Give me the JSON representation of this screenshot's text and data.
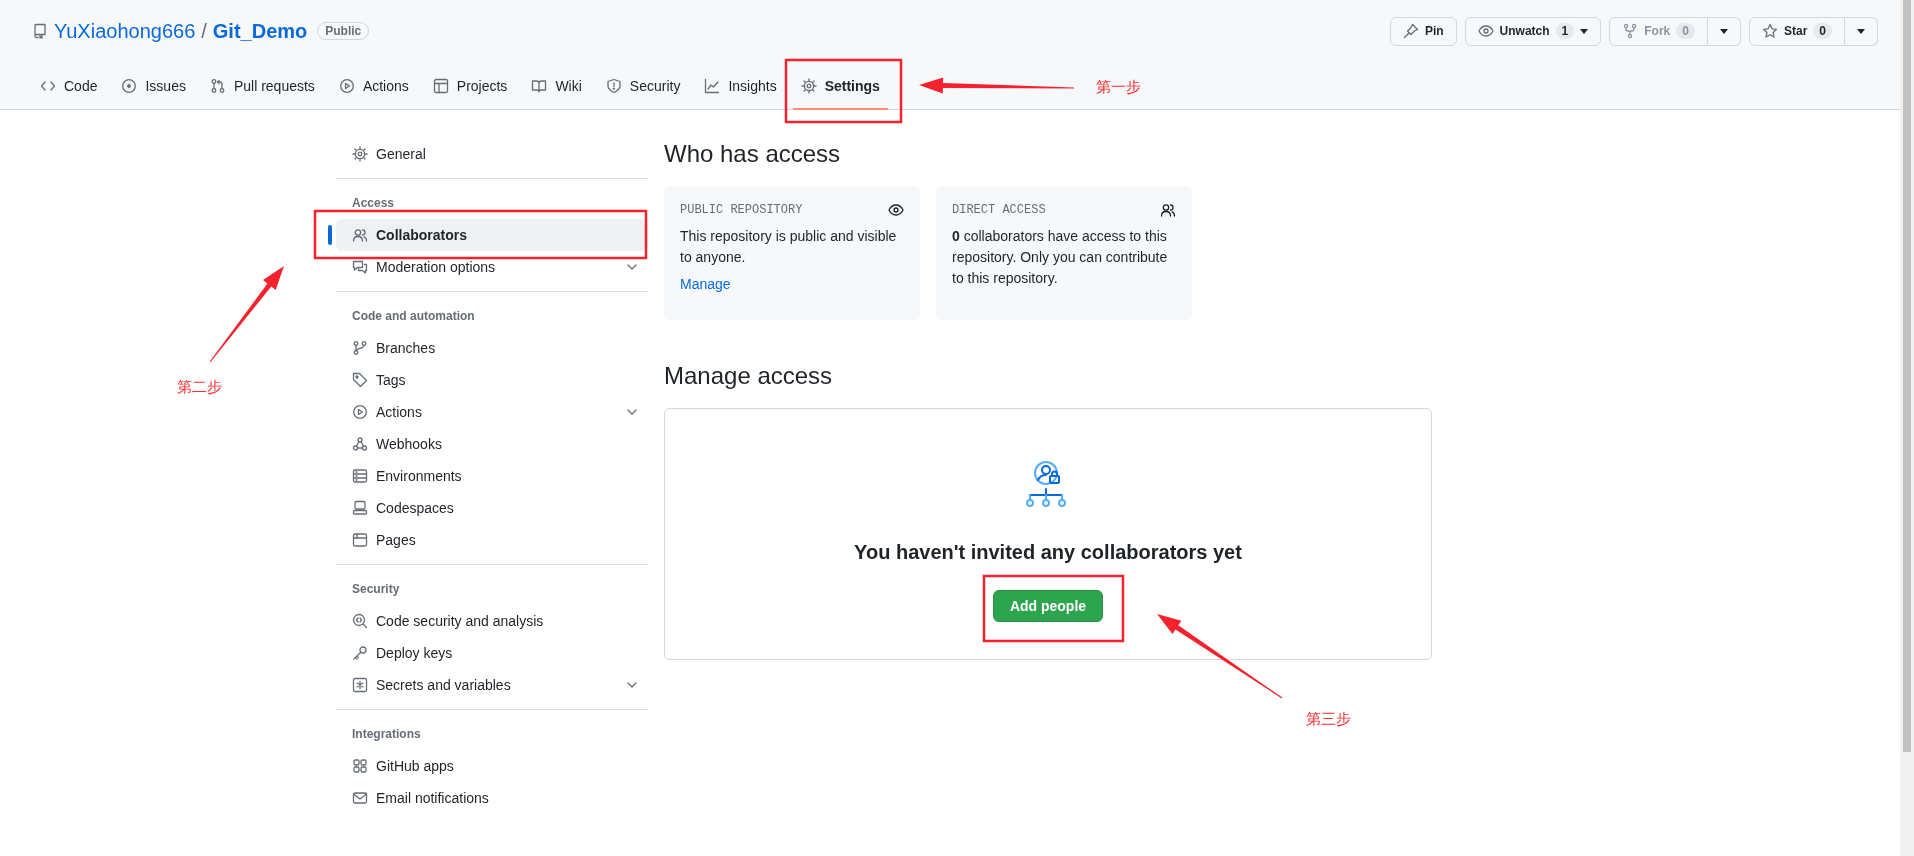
{
  "repo": {
    "owner": "YuXiaohong666",
    "separator": "/",
    "name": "Git_Demo",
    "visibility": "Public"
  },
  "header_buttons": [
    {
      "kind": "plain",
      "label": "Pin",
      "disabled": false
    },
    {
      "kind": "dropdown",
      "label": "Unwatch",
      "count": "1",
      "disabled": false
    },
    {
      "kind": "split",
      "label": "Fork",
      "count": "0",
      "disabled": true
    },
    {
      "kind": "split",
      "label": "Star",
      "count": "0",
      "disabled": false
    }
  ],
  "tabs": [
    {
      "label": "Code",
      "selected": false
    },
    {
      "label": "Issues",
      "selected": false
    },
    {
      "label": "Pull requests",
      "selected": false
    },
    {
      "label": "Actions",
      "selected": false
    },
    {
      "label": "Projects",
      "selected": false
    },
    {
      "label": "Wiki",
      "selected": false
    },
    {
      "label": "Security",
      "selected": false
    },
    {
      "label": "Insights",
      "selected": false
    },
    {
      "label": "Settings",
      "selected": true
    }
  ],
  "sidebar": {
    "sections": [
      {
        "items": [
          {
            "label": "General",
            "selected": false,
            "kind": "link"
          }
        ]
      },
      {
        "heading": "Access",
        "items": [
          {
            "label": "Collaborators",
            "selected": true,
            "kind": "link"
          },
          {
            "label": "Moderation options",
            "selected": false,
            "kind": "expandable"
          }
        ]
      },
      {
        "heading": "Code and automation",
        "items": [
          {
            "label": "Branches",
            "selected": false,
            "kind": "link"
          },
          {
            "label": "Tags",
            "selected": false,
            "kind": "link"
          },
          {
            "label": "Actions",
            "selected": false,
            "kind": "expandable"
          },
          {
            "label": "Webhooks",
            "selected": false,
            "kind": "link"
          },
          {
            "label": "Environments",
            "selected": false,
            "kind": "link"
          },
          {
            "label": "Codespaces",
            "selected": false,
            "kind": "link"
          },
          {
            "label": "Pages",
            "selected": false,
            "kind": "link"
          }
        ]
      },
      {
        "heading": "Security",
        "items": [
          {
            "label": "Code security and analysis",
            "selected": false,
            "kind": "link"
          },
          {
            "label": "Deploy keys",
            "selected": false,
            "kind": "link"
          },
          {
            "label": "Secrets and variables",
            "selected": false,
            "kind": "expandable"
          }
        ]
      },
      {
        "heading": "Integrations",
        "items": [
          {
            "label": "GitHub apps",
            "selected": false,
            "kind": "link"
          },
          {
            "label": "Email notifications",
            "selected": false,
            "kind": "link"
          }
        ]
      }
    ]
  },
  "who_has_access": {
    "title": "Who has access",
    "cards": [
      {
        "label": "PUBLIC REPOSITORY",
        "text": "This repository is public and visible to anyone.",
        "link": "Manage"
      },
      {
        "label": "DIRECT ACCESS",
        "text": "**0** collaborators have access to this repository. Only you can contribute to this repository."
      }
    ]
  },
  "manage_access": {
    "title": "Manage access",
    "empty_message": "You haven't invited any collaborators yet",
    "button": "Add people"
  },
  "annotations": [
    {
      "label": "第一步"
    },
    {
      "label": "第二步"
    },
    {
      "label": "第三步"
    }
  ]
}
